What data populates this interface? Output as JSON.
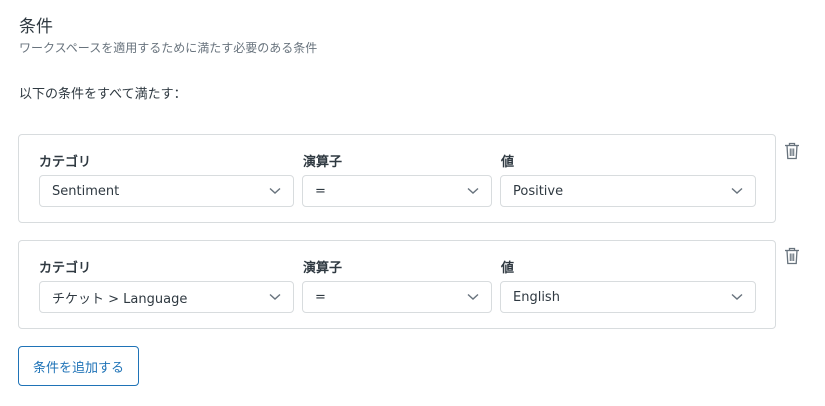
{
  "header": {
    "title": "条件",
    "subtitle": "ワークスペースを適用するために満たす必要のある条件"
  },
  "rule_label": "以下の条件をすべて満たす：",
  "conditions": [
    {
      "category_label": "カテゴリ",
      "operator_label": "演算子",
      "value_label": "値",
      "category": "Sentiment",
      "operator": "=",
      "value": "Positive"
    },
    {
      "category_label": "カテゴリ",
      "operator_label": "演算子",
      "value_label": "値",
      "category": "チケット > Language",
      "operator": "=",
      "value": "English"
    }
  ],
  "add_button_label": "条件を追加する",
  "icons": {
    "delete": "trash-icon",
    "dropdown": "chevron-down-icon"
  },
  "colors": {
    "accent": "#1f73b7",
    "border": "#d8dcde",
    "text": "#2f3941",
    "muted": "#68737d"
  }
}
